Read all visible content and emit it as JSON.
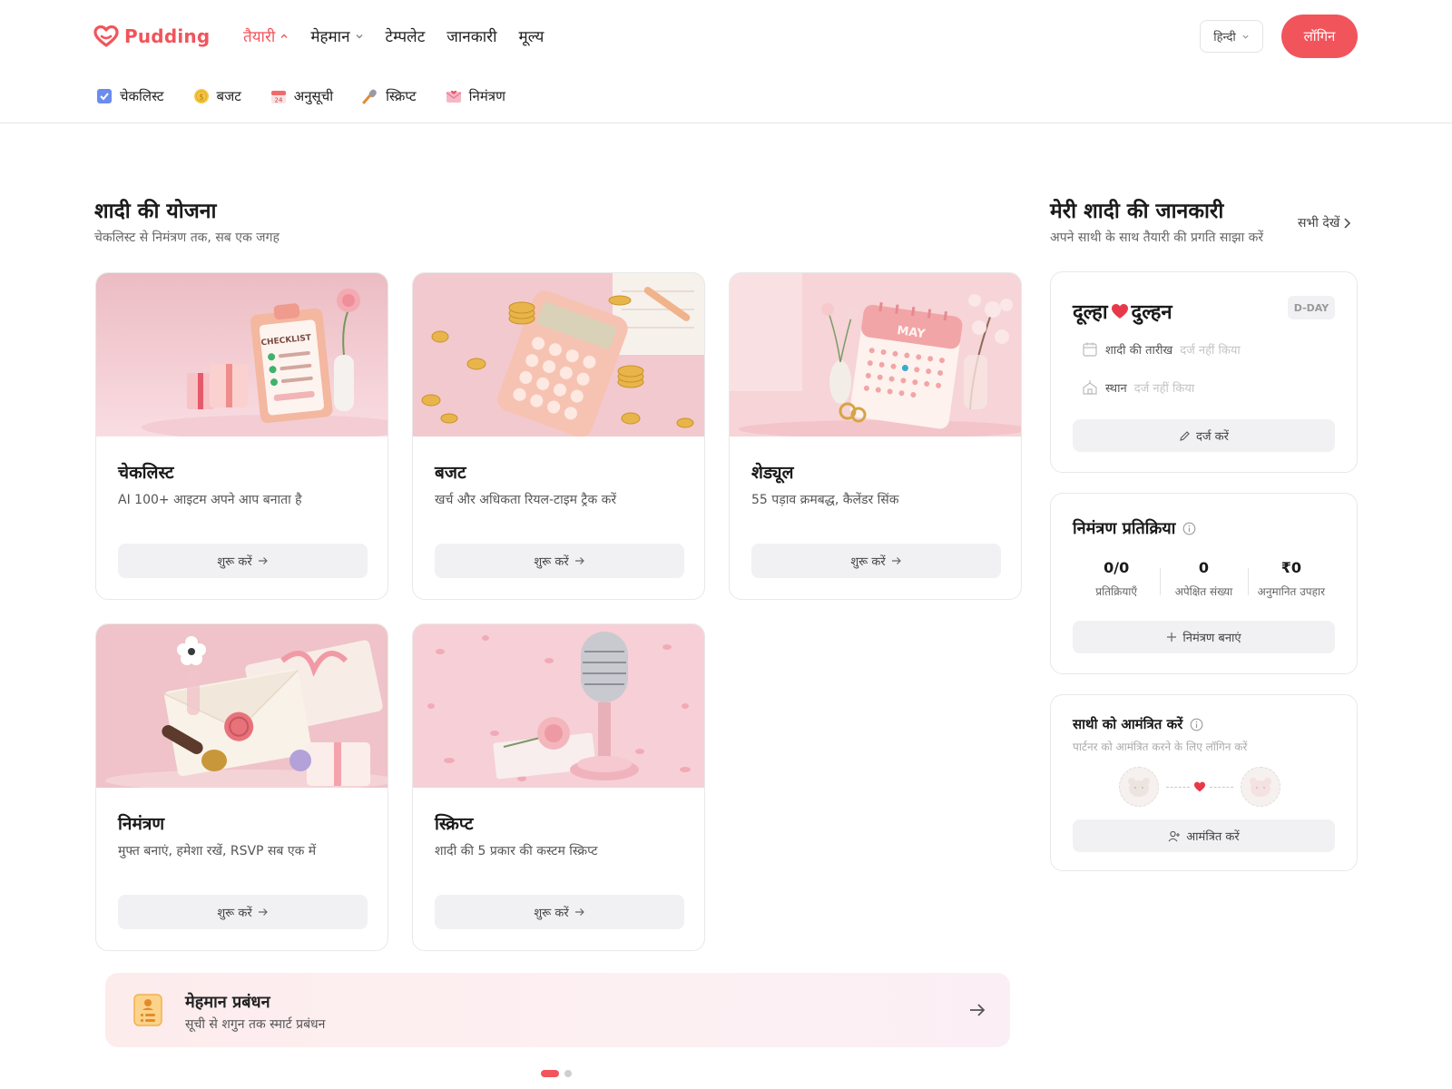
{
  "brand": {
    "name": "Pudding",
    "accent": "#f2545b"
  },
  "nav": {
    "items": [
      {
        "label": "तैयारी",
        "active": true,
        "dropdown": "up"
      },
      {
        "label": "मेहमान",
        "active": false,
        "dropdown": "down"
      },
      {
        "label": "टेम्पलेट",
        "active": false
      },
      {
        "label": "जानकारी",
        "active": false
      },
      {
        "label": "मूल्य",
        "active": false
      }
    ],
    "language": "हिन्दी",
    "login_label": "लॉगिन"
  },
  "subnav": {
    "items": [
      {
        "label": "चेकलिस्ट",
        "icon": "checkbox-icon"
      },
      {
        "label": "बजट",
        "icon": "coin-icon"
      },
      {
        "label": "अनुसूची",
        "icon": "calendar-icon"
      },
      {
        "label": "स्क्रिप्ट",
        "icon": "microphone-icon"
      },
      {
        "label": "निमंत्रण",
        "icon": "envelope-icon"
      }
    ]
  },
  "planning": {
    "title": "शादी की योजना",
    "subtitle": "चेकलिस्ट से निमंत्रण तक, सब एक जगह",
    "cards": [
      {
        "title": "चेकलिस्ट",
        "desc": "AI 100+ आइटम अपने आप बनाता है",
        "button": "शुरू करें",
        "image": "checklist-illustration"
      },
      {
        "title": "बजट",
        "desc": "खर्च और अधिकता रियल-टाइम ट्रैक करें",
        "button": "शुरू करें",
        "image": "calculator-illustration"
      },
      {
        "title": "शेड्यूल",
        "desc": "55 पड़ाव क्रमबद्ध, कैलेंडर सिंक",
        "button": "शुरू करें",
        "image": "calendar-illustration",
        "calendar_month": "MAY"
      },
      {
        "title": "निमंत्रण",
        "desc": "मुफ्त बनाएं, हमेशा रखें, RSVP सब एक में",
        "button": "शुरू करें",
        "image": "envelope-illustration"
      },
      {
        "title": "स्क्रिप्ट",
        "desc": "शादी की 5 प्रकार की कस्टम स्क्रिप्ट",
        "button": "शुरू करें",
        "image": "microphone-illustration"
      }
    ],
    "checklist_image_label": "CHECKLIST"
  },
  "guest_banner": {
    "title": "मेहमान प्रबंधन",
    "subtitle": "सूची से शगुन तक स्मार्ट प्रबंधन"
  },
  "carousel": {
    "pages": 2,
    "active": 0
  },
  "wedding_info": {
    "title": "मेरी शादी की जानकारी",
    "subtitle": "अपने साथी के साथ तैयारी की प्रगति साझा करें",
    "see_all": "सभी देखें",
    "groom": "दूल्हा",
    "bride": "दुल्हन",
    "dday": "D-DAY",
    "date_label": "शादी की तारीख",
    "date_value": "दर्ज नहीं किया",
    "venue_label": "स्थान",
    "venue_value": "दर्ज नहीं किया",
    "edit_button": "दर्ज करें"
  },
  "rsvp": {
    "title": "निमंत्रण प्रतिक्रिया",
    "stats": [
      {
        "value": "0/0",
        "label": "प्रतिक्रियाएँ"
      },
      {
        "value": "0",
        "label": "अपेक्षित संख्या"
      },
      {
        "value": "₹0",
        "label": "अनुमानित उपहार"
      }
    ],
    "button": "निमंत्रण बनाएं"
  },
  "partner": {
    "title": "साथी को आमंत्रित करें",
    "subtitle": "पार्टनर को आमंत्रित करने के लिए लॉगिन करें",
    "button": "आमंत्रित करें"
  }
}
